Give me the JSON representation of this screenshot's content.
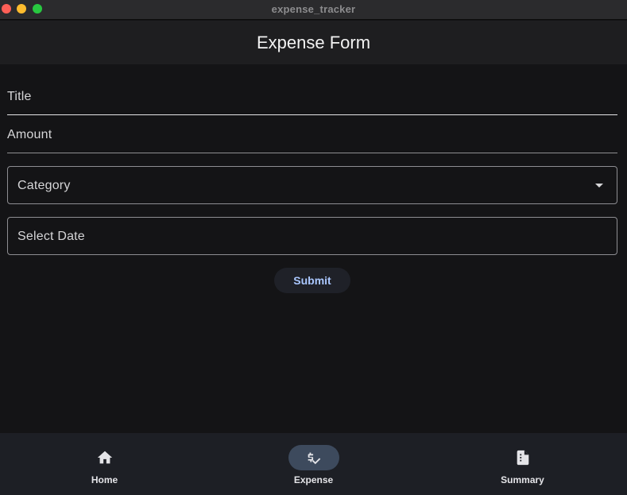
{
  "window": {
    "title": "expense_tracker"
  },
  "appbar": {
    "title": "Expense Form"
  },
  "form": {
    "title_label": "Title",
    "amount_label": "Amount",
    "category_label": "Category",
    "date_label": "Select Date",
    "submit_label": "Submit"
  },
  "bottom_nav": {
    "items": [
      {
        "label": "Home",
        "icon": "home-icon",
        "selected": false
      },
      {
        "label": "Expense",
        "icon": "price-check-icon",
        "selected": true
      },
      {
        "label": "Summary",
        "icon": "summary-icon",
        "selected": false
      }
    ]
  },
  "colors": {
    "background": "#141416",
    "appbar": "#1e1e20",
    "accent_text": "#aac7ff",
    "nav_background": "#1d1f25",
    "nav_selected_pill": "#3d4a5d"
  }
}
